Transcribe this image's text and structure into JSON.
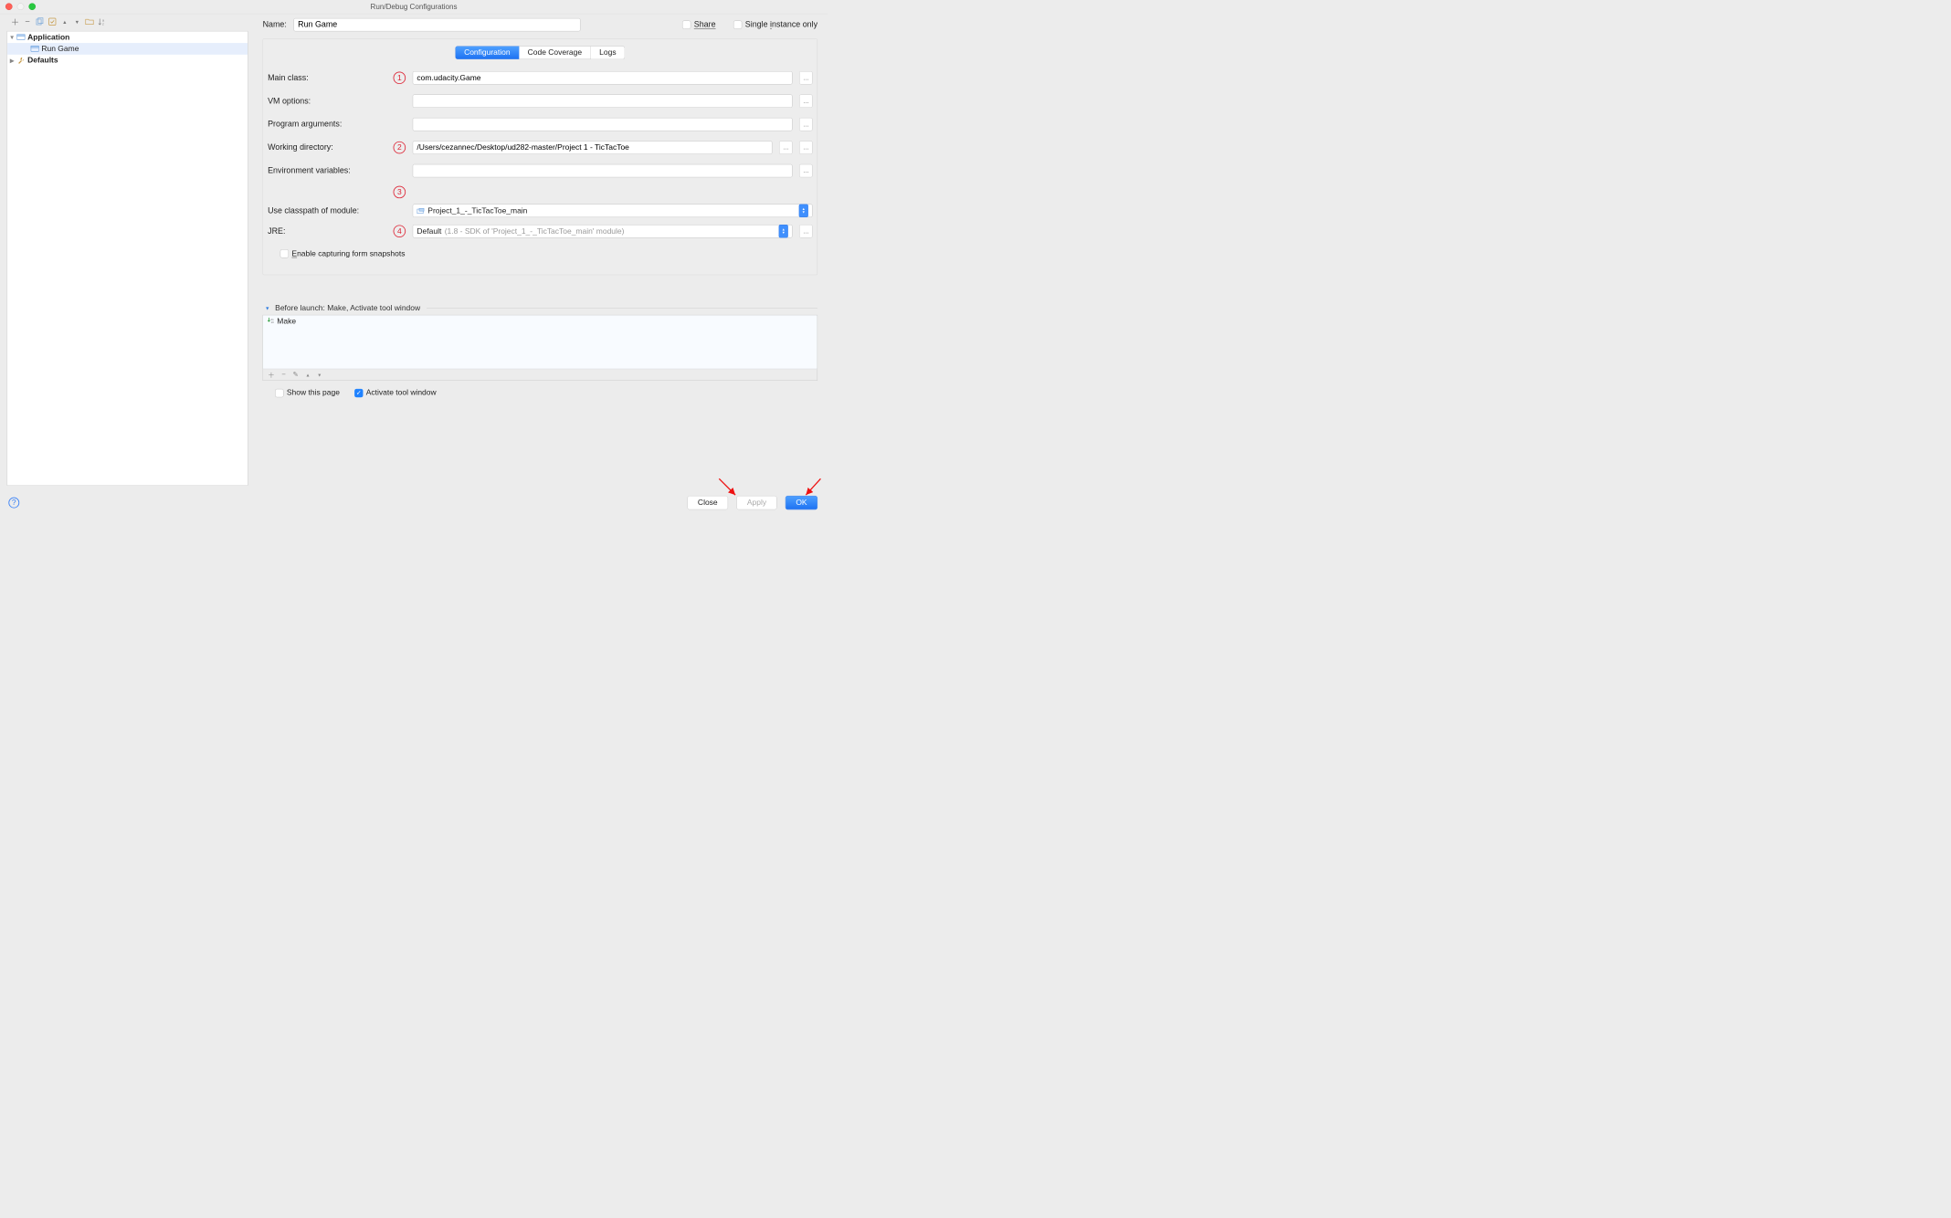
{
  "window": {
    "title": "Run/Debug Configurations"
  },
  "left": {
    "tree": {
      "application": "Application",
      "run_game": "Run Game",
      "defaults": "Defaults"
    }
  },
  "name_row": {
    "label": "Name:",
    "value": "Run Game",
    "share": "Share",
    "single_instance": "Single instance only"
  },
  "tabs": {
    "configuration": "Configuration",
    "code_coverage": "Code Coverage",
    "logs": "Logs"
  },
  "form": {
    "main_class": {
      "label": "Main class:",
      "value": "com.udacity.Game",
      "callout": "1"
    },
    "vm_options": {
      "label": "VM options:",
      "value": ""
    },
    "program_args": {
      "label": "Program arguments:",
      "value": ""
    },
    "working_dir": {
      "label": "Working directory:",
      "value": "/Users/cezannec/Desktop/ud282-master/Project 1 - TicTacToe",
      "callout": "2"
    },
    "env_vars": {
      "label": "Environment variables:",
      "value": ""
    },
    "classpath": {
      "label": "Use classpath of module:",
      "value": "Project_1_-_TicTacToe_main",
      "callout": "3"
    },
    "jre": {
      "label": "JRE:",
      "callout": "4",
      "value": "Default ",
      "hint": "(1.8 - SDK of 'Project_1_-_TicTacToe_main' module)"
    },
    "enable_snapshots": "Enable capturing form snapshots"
  },
  "before": {
    "header": "Before launch: Make, Activate tool window",
    "item": "Make"
  },
  "footer_checks": {
    "show_page": "Show this page",
    "activate": "Activate tool window"
  },
  "buttons": {
    "close": "Close",
    "apply": "Apply",
    "ok": "OK"
  }
}
